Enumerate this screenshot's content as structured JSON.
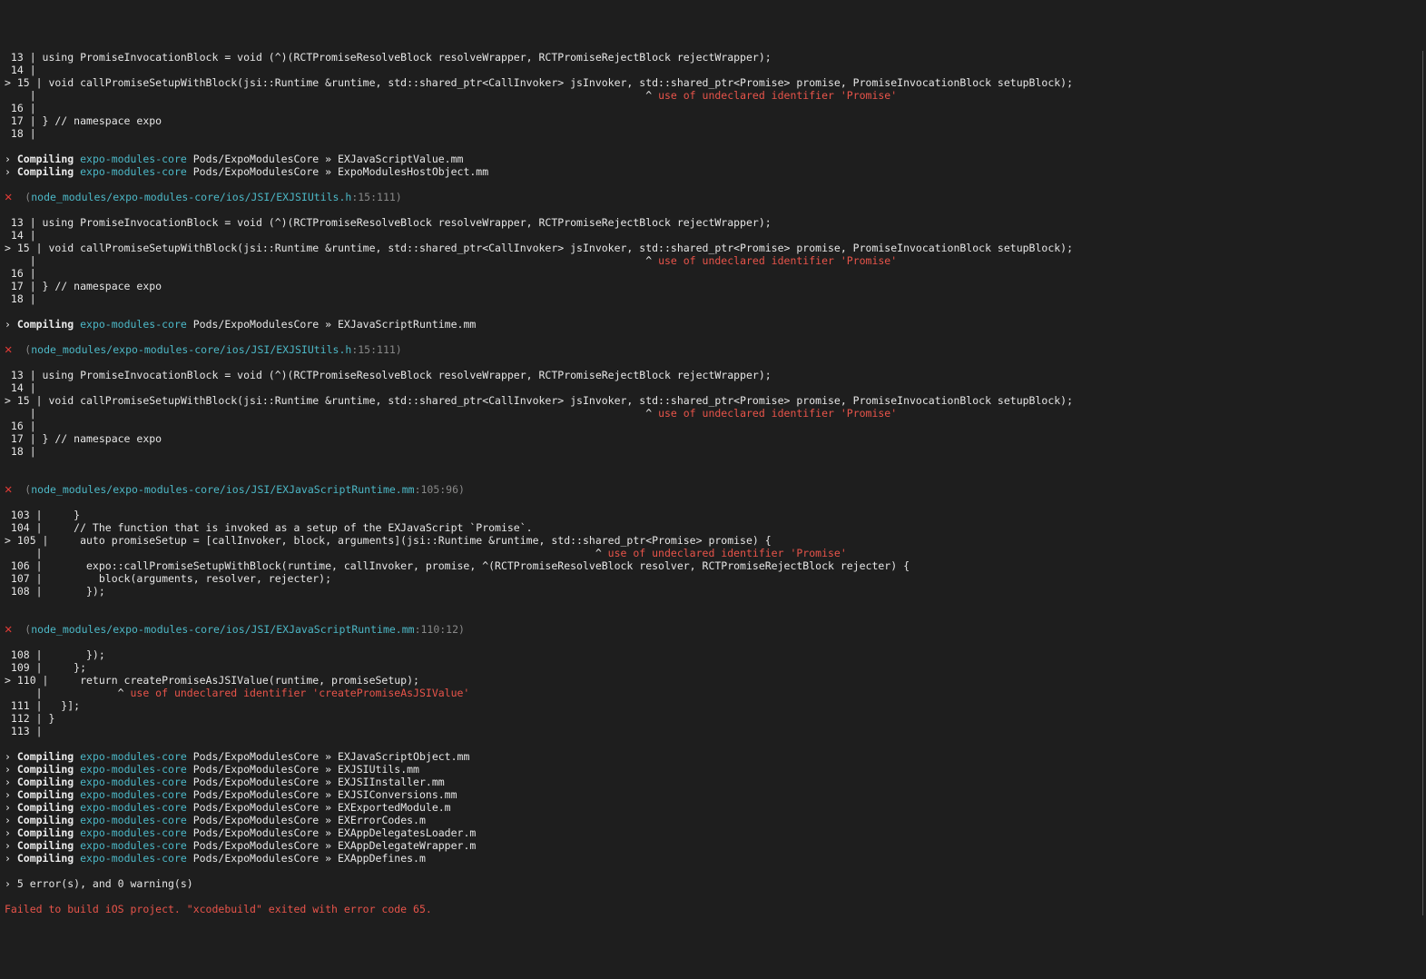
{
  "colors": {
    "background": "#1e1e1e",
    "text": "#d8d8d8",
    "error": "#e8544a",
    "package": "#4cb8c7",
    "location": "#888888"
  },
  "icons": {
    "error": "cross-mark-icon"
  },
  "lines": [
    {
      "kind": "code",
      "text": " 13 | using PromiseInvocationBlock = void (^)(RCTPromiseResolveBlock resolveWrapper, RCTPromiseRejectBlock rejectWrapper);"
    },
    {
      "kind": "code",
      "text": " 14 |"
    },
    {
      "kind": "code",
      "text": "> 15 | void callPromiseSetupWithBlock(jsi::Runtime &runtime, std::shared_ptr<CallInvoker> jsInvoker, std::shared_ptr<Promise> promise, PromiseInvocationBlock setupBlock);"
    },
    {
      "kind": "marker",
      "prefix": "    |                                                                                                 ^ ",
      "msg": "use of undeclared identifier 'Promise'"
    },
    {
      "kind": "code",
      "text": " 16 |"
    },
    {
      "kind": "code",
      "text": " 17 | } // namespace expo"
    },
    {
      "kind": "code",
      "text": " 18 |"
    },
    {
      "kind": "blank"
    },
    {
      "kind": "compile",
      "arrow": "› ",
      "verb": "Compiling",
      "pkg": "expo-modules-core",
      "target": " Pods/ExpoModulesCore » EXJavaScriptValue.mm"
    },
    {
      "kind": "compile",
      "arrow": "› ",
      "verb": "Compiling",
      "pkg": "expo-modules-core",
      "target": " Pods/ExpoModulesCore » ExpoModulesHostObject.mm"
    },
    {
      "kind": "blank"
    },
    {
      "kind": "error",
      "path": "node_modules/expo-modules-core/ios/JSI/EXJSIUtils.h",
      "loc": ":15:111"
    },
    {
      "kind": "blank"
    },
    {
      "kind": "code",
      "text": " 13 | using PromiseInvocationBlock = void (^)(RCTPromiseResolveBlock resolveWrapper, RCTPromiseRejectBlock rejectWrapper);"
    },
    {
      "kind": "code",
      "text": " 14 |"
    },
    {
      "kind": "code",
      "text": "> 15 | void callPromiseSetupWithBlock(jsi::Runtime &runtime, std::shared_ptr<CallInvoker> jsInvoker, std::shared_ptr<Promise> promise, PromiseInvocationBlock setupBlock);"
    },
    {
      "kind": "marker",
      "prefix": "    |                                                                                                 ^ ",
      "msg": "use of undeclared identifier 'Promise'"
    },
    {
      "kind": "code",
      "text": " 16 |"
    },
    {
      "kind": "code",
      "text": " 17 | } // namespace expo"
    },
    {
      "kind": "code",
      "text": " 18 |"
    },
    {
      "kind": "blank"
    },
    {
      "kind": "compile",
      "arrow": "› ",
      "verb": "Compiling",
      "pkg": "expo-modules-core",
      "target": " Pods/ExpoModulesCore » EXJavaScriptRuntime.mm"
    },
    {
      "kind": "blank"
    },
    {
      "kind": "error",
      "path": "node_modules/expo-modules-core/ios/JSI/EXJSIUtils.h",
      "loc": ":15:111"
    },
    {
      "kind": "blank"
    },
    {
      "kind": "code",
      "text": " 13 | using PromiseInvocationBlock = void (^)(RCTPromiseResolveBlock resolveWrapper, RCTPromiseRejectBlock rejectWrapper);"
    },
    {
      "kind": "code",
      "text": " 14 |"
    },
    {
      "kind": "code",
      "text": "> 15 | void callPromiseSetupWithBlock(jsi::Runtime &runtime, std::shared_ptr<CallInvoker> jsInvoker, std::shared_ptr<Promise> promise, PromiseInvocationBlock setupBlock);"
    },
    {
      "kind": "marker",
      "prefix": "    |                                                                                                 ^ ",
      "msg": "use of undeclared identifier 'Promise'"
    },
    {
      "kind": "code",
      "text": " 16 |"
    },
    {
      "kind": "code",
      "text": " 17 | } // namespace expo"
    },
    {
      "kind": "code",
      "text": " 18 |"
    },
    {
      "kind": "blank"
    },
    {
      "kind": "blank"
    },
    {
      "kind": "error",
      "path": "node_modules/expo-modules-core/ios/JSI/EXJavaScriptRuntime.mm",
      "loc": ":105:96"
    },
    {
      "kind": "blank"
    },
    {
      "kind": "code",
      "text": " 103 |     }"
    },
    {
      "kind": "code",
      "text": " 104 |     // The function that is invoked as a setup of the EXJavaScript `Promise`."
    },
    {
      "kind": "code",
      "text": "> 105 |     auto promiseSetup = [callInvoker, block, arguments](jsi::Runtime &runtime, std::shared_ptr<Promise> promise) {"
    },
    {
      "kind": "marker",
      "prefix": "     |                                                                                        ^ ",
      "msg": "use of undeclared identifier 'Promise'"
    },
    {
      "kind": "code",
      "text": " 106 |       expo::callPromiseSetupWithBlock(runtime, callInvoker, promise, ^(RCTPromiseResolveBlock resolver, RCTPromiseRejectBlock rejecter) {"
    },
    {
      "kind": "code",
      "text": " 107 |         block(arguments, resolver, rejecter);"
    },
    {
      "kind": "code",
      "text": " 108 |       });"
    },
    {
      "kind": "blank"
    },
    {
      "kind": "blank"
    },
    {
      "kind": "error",
      "path": "node_modules/expo-modules-core/ios/JSI/EXJavaScriptRuntime.mm",
      "loc": ":110:12"
    },
    {
      "kind": "blank"
    },
    {
      "kind": "code",
      "text": " 108 |       });"
    },
    {
      "kind": "code",
      "text": " 109 |     };"
    },
    {
      "kind": "code",
      "text": "> 110 |     return createPromiseAsJSIValue(runtime, promiseSetup);"
    },
    {
      "kind": "marker",
      "prefix": "     |            ^ ",
      "msg": "use of undeclared identifier 'createPromiseAsJSIValue'"
    },
    {
      "kind": "code",
      "text": " 111 |   }];"
    },
    {
      "kind": "code",
      "text": " 112 | }"
    },
    {
      "kind": "code",
      "text": " 113 |"
    },
    {
      "kind": "blank"
    },
    {
      "kind": "compile",
      "arrow": "› ",
      "verb": "Compiling",
      "pkg": "expo-modules-core",
      "target": " Pods/ExpoModulesCore » EXJavaScriptObject.mm"
    },
    {
      "kind": "compile",
      "arrow": "› ",
      "verb": "Compiling",
      "pkg": "expo-modules-core",
      "target": " Pods/ExpoModulesCore » EXJSIUtils.mm"
    },
    {
      "kind": "compile",
      "arrow": "› ",
      "verb": "Compiling",
      "pkg": "expo-modules-core",
      "target": " Pods/ExpoModulesCore » EXJSIInstaller.mm"
    },
    {
      "kind": "compile",
      "arrow": "› ",
      "verb": "Compiling",
      "pkg": "expo-modules-core",
      "target": " Pods/ExpoModulesCore » EXJSIConversions.mm"
    },
    {
      "kind": "compile",
      "arrow": "› ",
      "verb": "Compiling",
      "pkg": "expo-modules-core",
      "target": " Pods/ExpoModulesCore » EXExportedModule.m"
    },
    {
      "kind": "compile",
      "arrow": "› ",
      "verb": "Compiling",
      "pkg": "expo-modules-core",
      "target": " Pods/ExpoModulesCore » EXErrorCodes.m"
    },
    {
      "kind": "compile",
      "arrow": "› ",
      "verb": "Compiling",
      "pkg": "expo-modules-core",
      "target": " Pods/ExpoModulesCore » EXAppDelegatesLoader.m"
    },
    {
      "kind": "compile",
      "arrow": "› ",
      "verb": "Compiling",
      "pkg": "expo-modules-core",
      "target": " Pods/ExpoModulesCore » EXAppDelegateWrapper.m"
    },
    {
      "kind": "compile",
      "arrow": "› ",
      "verb": "Compiling",
      "pkg": "expo-modules-core",
      "target": " Pods/ExpoModulesCore » EXAppDefines.m"
    },
    {
      "kind": "blank"
    },
    {
      "kind": "summary",
      "text": "› 5 error(s), and 0 warning(s)"
    },
    {
      "kind": "blank"
    },
    {
      "kind": "fail",
      "text": "Failed to build iOS project. \"xcodebuild\" exited with error code 65."
    }
  ]
}
